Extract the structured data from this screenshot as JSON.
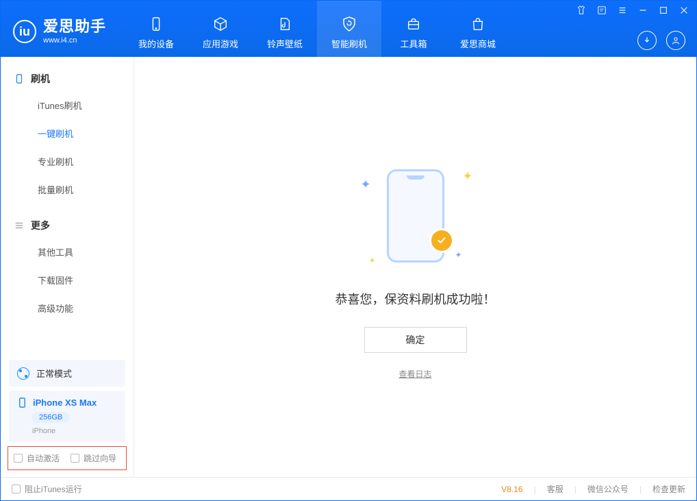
{
  "app": {
    "name": "爱思助手",
    "url": "www.i4.cn"
  },
  "tabs": [
    {
      "label": "我的设备"
    },
    {
      "label": "应用游戏"
    },
    {
      "label": "铃声壁纸"
    },
    {
      "label": "智能刷机"
    },
    {
      "label": "工具箱"
    },
    {
      "label": "爱思商城"
    }
  ],
  "sidebar": {
    "group1": "刷机",
    "items1": [
      "iTunes刷机",
      "一键刷机",
      "专业刷机",
      "批量刷机"
    ],
    "group2": "更多",
    "items2": [
      "其他工具",
      "下载固件",
      "高级功能"
    ]
  },
  "mode": {
    "label": "正常模式"
  },
  "device": {
    "name": "iPhone XS Max",
    "capacity": "256GB",
    "kind": "iPhone"
  },
  "options": {
    "auto_activate": "自动激活",
    "skip_guide": "跳过向导"
  },
  "main": {
    "success": "恭喜您，保资料刷机成功啦！",
    "confirm": "确定",
    "view_log": "查看日志"
  },
  "status": {
    "block_itunes": "阻止iTunes运行",
    "version": "V8.16",
    "support": "客服",
    "wechat": "微信公众号",
    "update": "检查更新"
  }
}
